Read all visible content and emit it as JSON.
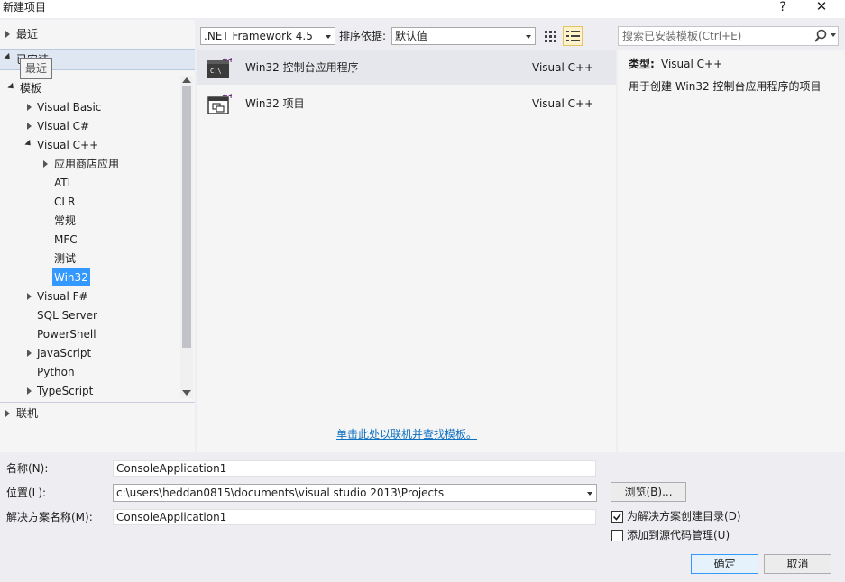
{
  "window": {
    "title": "新建项目",
    "help": "?",
    "close": "✕"
  },
  "left_panel": {
    "recent": "最近",
    "installed": "已安装",
    "tooltip": "最近",
    "templates": "模板",
    "tree": [
      {
        "label": "Visual Basic"
      },
      {
        "label": "Visual C#"
      },
      {
        "label": "Visual C++"
      },
      {
        "label": "应用商店应用"
      },
      {
        "label": "ATL"
      },
      {
        "label": "CLR"
      },
      {
        "label": "常规"
      },
      {
        "label": "MFC"
      },
      {
        "label": "测试"
      },
      {
        "label": "Win32"
      },
      {
        "label": "Visual F#"
      },
      {
        "label": "SQL Server"
      },
      {
        "label": "PowerShell"
      },
      {
        "label": "JavaScript"
      },
      {
        "label": "Python"
      },
      {
        "label": "TypeScript"
      }
    ],
    "online": "联机"
  },
  "toolbar": {
    "framework": ".NET Framework 4.5",
    "sort_label": "排序依据:",
    "sort_value": "默认值",
    "search_placeholder": "搜索已安装模板(Ctrl+E)"
  },
  "templates": [
    {
      "name": "Win32 控制台应用程序",
      "lang": "Visual C++",
      "icon": "console-app-icon"
    },
    {
      "name": "Win32 项目",
      "lang": "Visual C++",
      "icon": "win32-project-icon"
    }
  ],
  "online_link": "单击此处以联机并查找模板。",
  "details": {
    "type_label": "类型:",
    "type_value": "Visual C++",
    "description": "用于创建 Win32 控制台应用程序的项目"
  },
  "form": {
    "name_label": "名称(N):",
    "name_value": "ConsoleApplication1",
    "location_label": "位置(L):",
    "location_value": "c:\\users\\heddan0815\\documents\\visual studio 2013\\Projects",
    "solution_label": "解决方案名称(M):",
    "solution_value": "ConsoleApplication1",
    "browse": "浏览(B)...",
    "create_dir": "为解决方案创建目录(D)",
    "create_dir_checked": true,
    "add_source": "添加到源代码管理(U)",
    "add_source_checked": false,
    "ok": "确定",
    "cancel": "取消"
  },
  "colors": {
    "selection": "#3399ff",
    "link": "#0e70c0",
    "panel": "#f5f5f5"
  }
}
